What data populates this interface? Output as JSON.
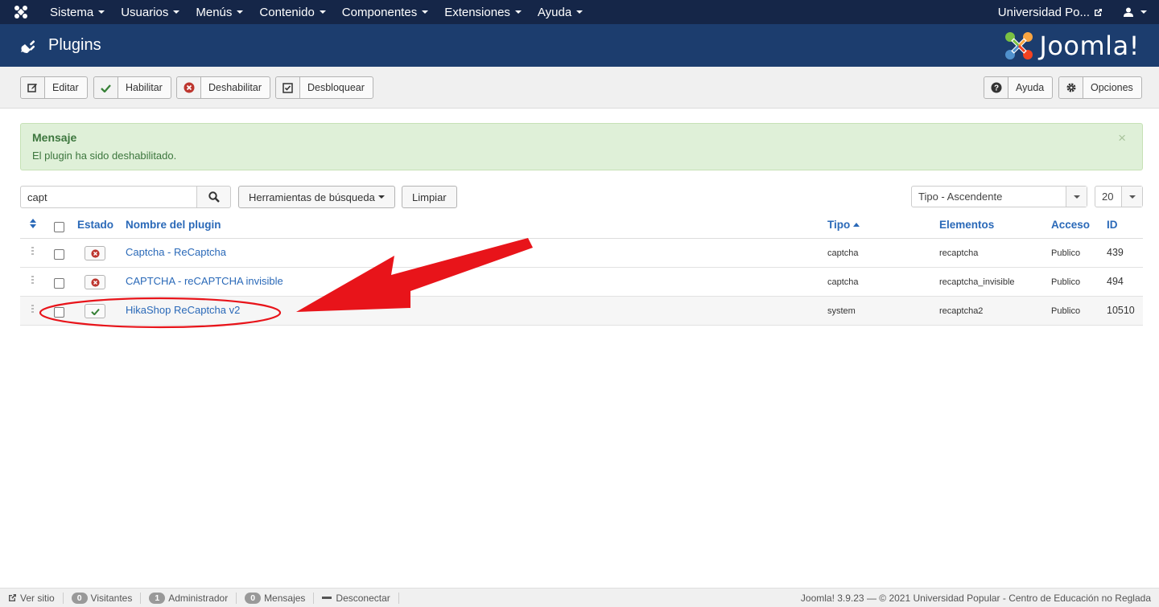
{
  "topnav": {
    "menu": [
      "Sistema",
      "Usuarios",
      "Menús",
      "Contenido",
      "Componentes",
      "Extensiones",
      "Ayuda"
    ],
    "site_name": "Universidad Po..."
  },
  "header": {
    "title": "Plugins",
    "brand": "Joomla!"
  },
  "toolbar": {
    "edit": "Editar",
    "enable": "Habilitar",
    "disable": "Deshabilitar",
    "unlock": "Desbloquear",
    "help": "Ayuda",
    "options": "Opciones"
  },
  "message": {
    "title": "Mensaje",
    "text": "El plugin ha sido deshabilitado.",
    "close": "×"
  },
  "filters": {
    "search_value": "capt",
    "tools": "Herramientas de búsqueda",
    "clear": "Limpiar",
    "sort": "Tipo - Ascendente",
    "limit": "20"
  },
  "table": {
    "headers": {
      "status": "Estado",
      "name": "Nombre del plugin",
      "type": "Tipo",
      "elements": "Elementos",
      "access": "Acceso",
      "id": "ID"
    },
    "rows": [
      {
        "name": "Captcha - ReCaptcha",
        "type": "captcha",
        "element": "recaptcha",
        "access": "Publico",
        "id": "439",
        "enabled": false
      },
      {
        "name": "CAPTCHA - reCAPTCHA invisible",
        "type": "captcha",
        "element": "recaptcha_invisible",
        "access": "Publico",
        "id": "494",
        "enabled": false
      },
      {
        "name": "HikaShop ReCaptcha v2",
        "type": "system",
        "element": "recaptcha2",
        "access": "Publico",
        "id": "10510",
        "enabled": true
      }
    ]
  },
  "footer": {
    "view_site": "Ver sitio",
    "visitors_count": "0",
    "visitors": "Visitantes",
    "admins_count": "1",
    "admins": "Administrador",
    "messages_count": "0",
    "messages": "Mensajes",
    "logout": "Desconectar",
    "copyright": "Joomla! 3.9.23  —  © 2021 Universidad Popular - Centro de Educación no Reglada"
  },
  "colors": {
    "navbar": "#152648",
    "header": "#1c3d6e",
    "link": "#2a69b8",
    "success_bg": "#dff0d8",
    "annotation": "#e8141a"
  }
}
